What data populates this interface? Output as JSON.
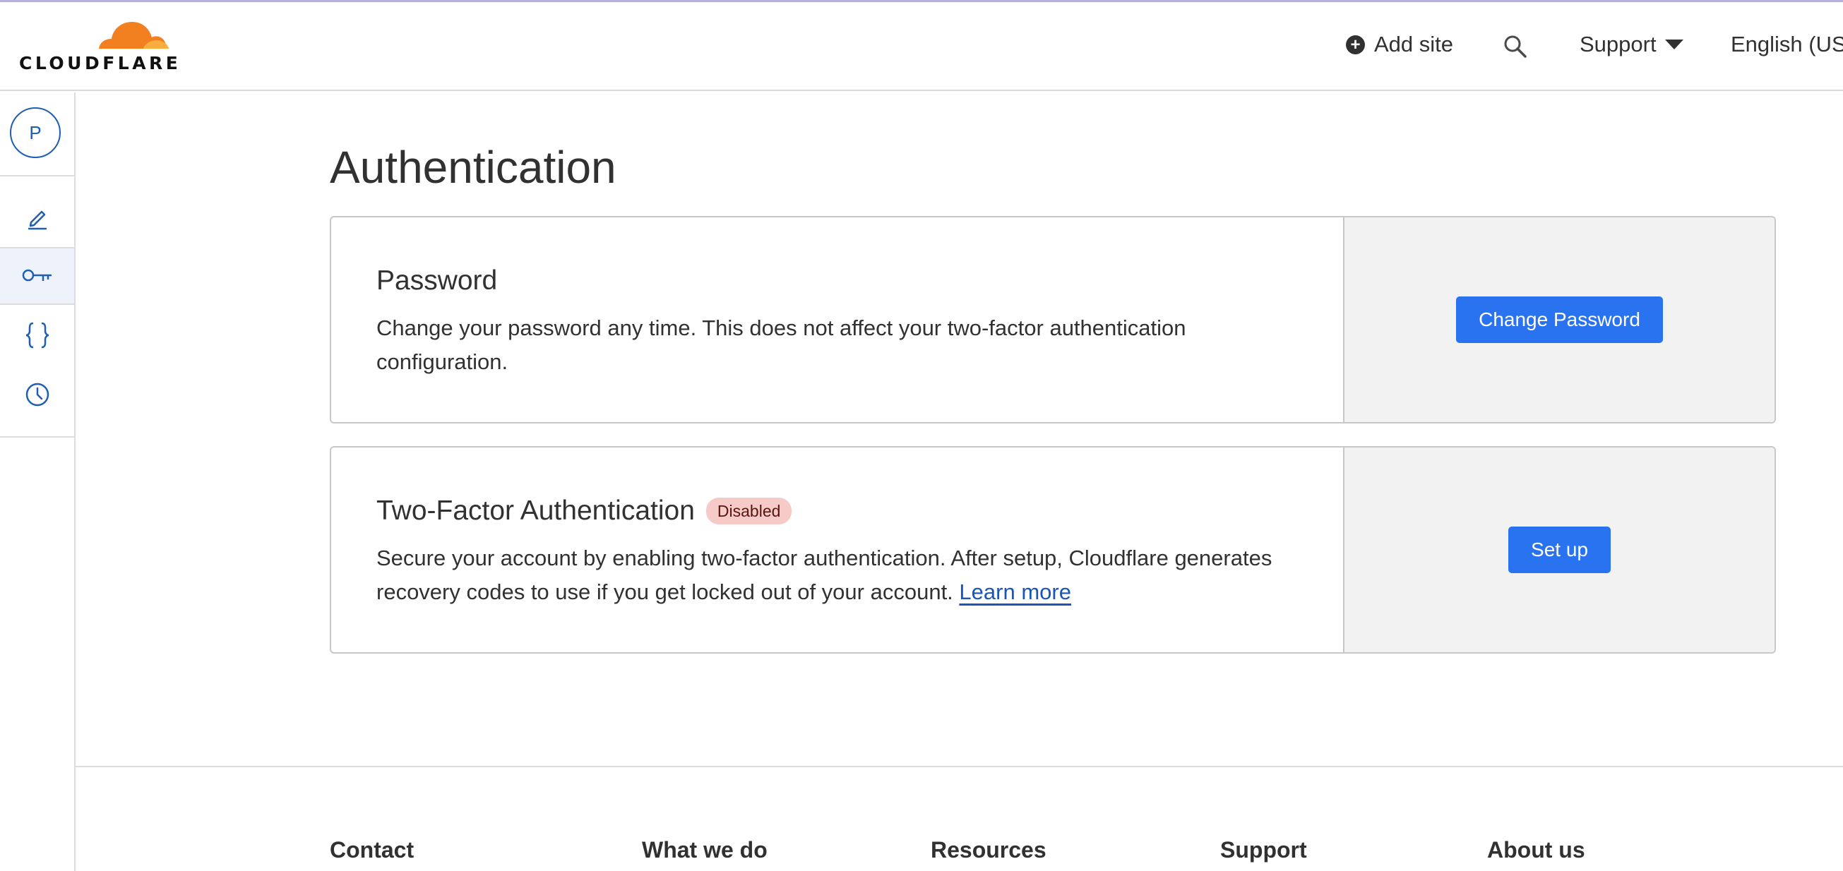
{
  "header": {
    "logo_text": "CLOUDFLARE",
    "add_site_label": "Add site",
    "support_label": "Support",
    "language_label": "English (US"
  },
  "sidebar": {
    "avatar_initial": "P",
    "items": [
      {
        "name": "edit-icon",
        "active": false
      },
      {
        "name": "key-icon",
        "active": true
      },
      {
        "name": "braces-icon",
        "active": false
      },
      {
        "name": "clock-icon",
        "active": false
      }
    ]
  },
  "page": {
    "title": "Authentication"
  },
  "password_card": {
    "title": "Password",
    "description": "Change your password any time. This does not affect your two-factor authentication configuration.",
    "button_label": "Change Password"
  },
  "twofa_card": {
    "title": "Two-Factor Authentication",
    "status_badge": "Disabled",
    "description": "Secure your account by enabling two-factor authentication. After setup, Cloudflare generates recovery codes to use if you get locked out of your account.",
    "learn_more_label": "Learn more",
    "button_label": "Set up"
  },
  "footer": {
    "columns": [
      "Contact",
      "What we do",
      "Resources",
      "Support",
      "About us"
    ]
  },
  "colors": {
    "accent": "#2a73f0",
    "link": "#1a55b8",
    "badge_bg": "#f6cac6",
    "panel_bg": "#f2f2f2",
    "logo_orange": "#f38020"
  }
}
